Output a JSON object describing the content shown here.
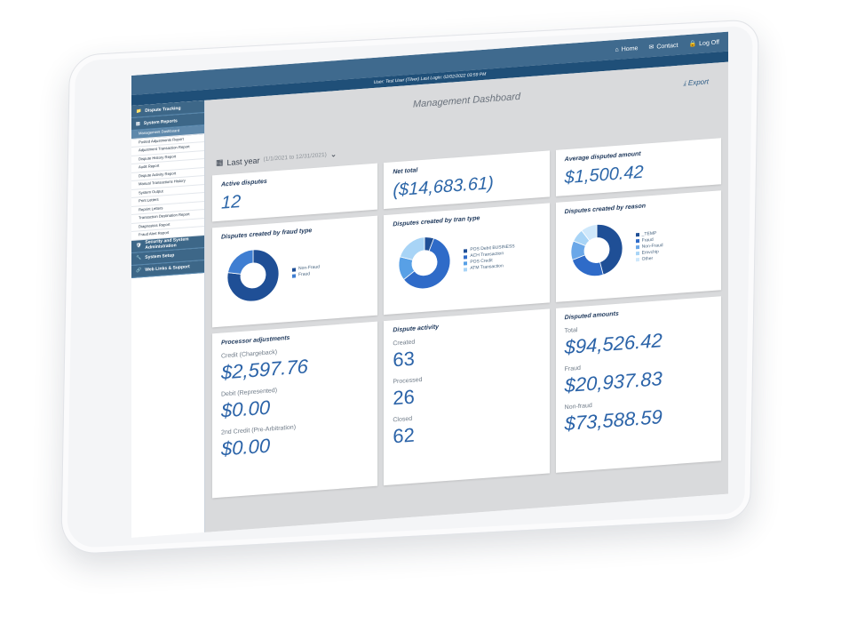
{
  "topbar": {
    "home": "Home",
    "contact": "Contact",
    "logoff": "Log Off"
  },
  "userbar": {
    "text": "User: Test User (Tilver)   Last Login: 02/02/2022 03:59 PM"
  },
  "sidebar": {
    "sections": [
      {
        "label": "Dispute Tracking"
      },
      {
        "label": "System Reports"
      },
      {
        "label": "Security and System Administration"
      },
      {
        "label": "System Setup"
      },
      {
        "label": "Web Links & Support"
      }
    ],
    "report_items": [
      "Management Dashboard",
      "Posted Adjustments Report",
      "Adjustment Transaction Report",
      "Dispute History Report",
      "Audit Report",
      "Dispute Activity Report",
      "Manual Transactions History",
      "System Output",
      "Print Letters",
      "Reprint Letters",
      "Transaction Destination Report",
      "Diagnostics Report",
      "Fraud Alert Report"
    ]
  },
  "header": {
    "title": "Management Dashboard",
    "export": "Export"
  },
  "filter": {
    "label": "Last year",
    "range": "(1/1/2021 to 12/31/2021)"
  },
  "cards": {
    "active": {
      "title": "Active disputes",
      "value": "12"
    },
    "net": {
      "title": "Net total",
      "value": "($14,683.61)"
    },
    "avg": {
      "title": "Average disputed amount",
      "value": "$1,500.42"
    },
    "fraud_type": {
      "title": "Disputes created by fraud type",
      "legend": [
        "Non-Fraud",
        "Fraud"
      ]
    },
    "tran_type": {
      "title": "Disputes created by tran type",
      "legend": [
        "POS Debit BUSINESS",
        "ACH Transaction",
        "POS Credit",
        "ATM Transaction"
      ]
    },
    "reason": {
      "title": "Disputes created by reason",
      "legend": [
        "_TEMP",
        "Fraud",
        "Non-Fraud",
        "Emvchip",
        "Other"
      ]
    },
    "processor": {
      "title": "Processor adjustments",
      "credit_label": "Credit (Chargeback)",
      "credit": "$2,597.76",
      "debit_label": "Debit (Represented)",
      "debit": "$0.00",
      "second_label": "2nd Credit (Pre-Arbitration)",
      "second": "$0.00"
    },
    "activity": {
      "title": "Dispute activity",
      "created_label": "Created",
      "created": "63",
      "processed_label": "Processed",
      "processed": "26",
      "closed_label": "Closed",
      "closed": "62"
    },
    "amounts": {
      "title": "Disputed amounts",
      "total_label": "Total",
      "total": "$94,526.42",
      "fraud_label": "Fraud",
      "fraud": "$20,937.83",
      "nonfraud_label": "Non-fraud",
      "nonfraud": "$73,588.59"
    }
  },
  "chart_data": [
    {
      "type": "pie",
      "title": "Disputes created by fraud type",
      "categories": [
        "Non-Fraud",
        "Fraud"
      ],
      "values": [
        0.78,
        0.22
      ],
      "colors": [
        "#1f4f96",
        "#3f7ed2"
      ]
    },
    {
      "type": "pie",
      "title": "Disputes created by tran type",
      "categories": [
        "POS Debit BUSINESS",
        "ACH Transaction",
        "POS Credit",
        "ATM Transaction"
      ],
      "values": [
        0.06,
        0.59,
        0.15,
        0.2
      ],
      "colors": [
        "#1f4f96",
        "#2f6bc8",
        "#58a0e6",
        "#a8d4f6"
      ]
    },
    {
      "type": "pie",
      "title": "Disputes created by reason",
      "categories": [
        "_TEMP",
        "Fraud",
        "Non-Fraud",
        "Emvchip",
        "Other"
      ],
      "values": [
        0.46,
        0.24,
        0.12,
        0.08,
        0.1
      ],
      "colors": [
        "#1f4f96",
        "#2f6bc8",
        "#6aa7e8",
        "#a8d4f6",
        "#cfe8fb"
      ]
    }
  ]
}
